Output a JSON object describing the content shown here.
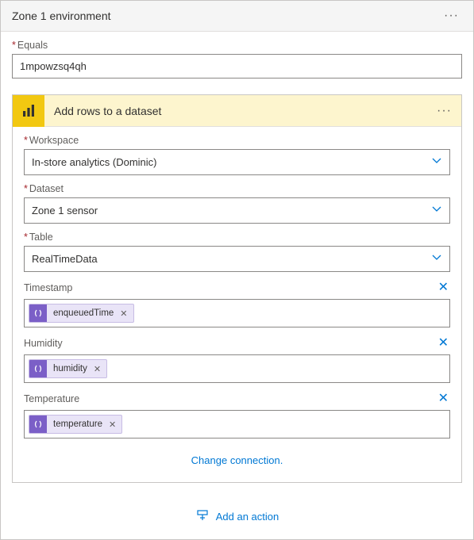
{
  "panel": {
    "title": "Zone 1 environment"
  },
  "equals": {
    "label": "Equals",
    "value": "1mpowzsq4qh"
  },
  "action": {
    "title": "Add rows to a dataset",
    "workspace": {
      "label": "Workspace",
      "value": "In-store analytics (Dominic)"
    },
    "dataset": {
      "label": "Dataset",
      "value": "Zone 1 sensor"
    },
    "table": {
      "label": "Table",
      "value": "RealTimeData"
    },
    "timestamp": {
      "label": "Timestamp",
      "token": "enqueuedTime"
    },
    "humidity": {
      "label": "Humidity",
      "token": "humidity"
    },
    "temperature": {
      "label": "Temperature",
      "token": "temperature"
    },
    "change_connection": "Change connection."
  },
  "footer": {
    "add_action": "Add an action"
  }
}
